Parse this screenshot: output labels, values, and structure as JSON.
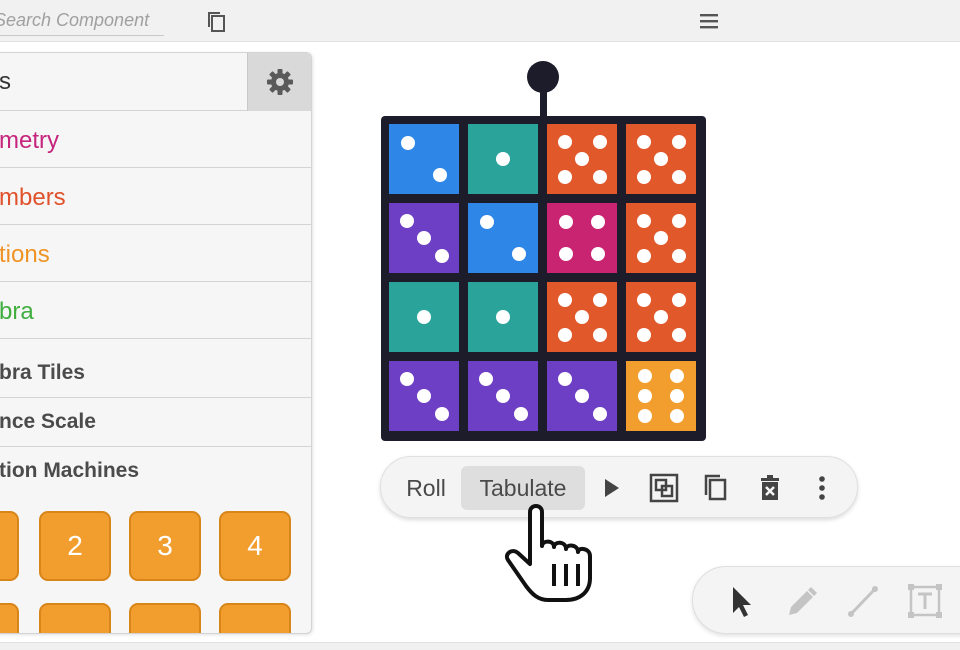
{
  "topbar": {
    "search_placeholder": "Search Component",
    "copy_icon": "copy-icon",
    "menu_icon": "hamburger-menu-icon"
  },
  "panel": {
    "title": "s",
    "gear_icon": "gear-icon",
    "categories": [
      {
        "label": "metry",
        "color": "#c6257d"
      },
      {
        "label": "mbers",
        "color": "#e0522b"
      },
      {
        "label": "tions",
        "color": "#ef9424"
      },
      {
        "label": "bra",
        "color": "#3fae3f"
      }
    ],
    "subcategories": [
      "bra Tiles",
      "nce Scale",
      "tion Machines"
    ],
    "number_tiles": [
      "",
      "2",
      "3",
      "4",
      "",
      "",
      "",
      ""
    ]
  },
  "dice": {
    "colors": {
      "blue": "#2e86e6",
      "teal": "#2aa39b",
      "orange": "#e1582b",
      "purple": "#6d3fc4",
      "magenta": "#c82472",
      "yellow": "#f19e2e"
    },
    "grid": [
      [
        {
          "color": "blue",
          "value": 2
        },
        {
          "color": "teal",
          "value": 1
        },
        {
          "color": "orange",
          "value": 5
        },
        {
          "color": "orange",
          "value": 5
        }
      ],
      [
        {
          "color": "purple",
          "value": 3
        },
        {
          "color": "blue",
          "value": 2
        },
        {
          "color": "magenta",
          "value": 4
        },
        {
          "color": "orange",
          "value": 5
        }
      ],
      [
        {
          "color": "teal",
          "value": 1
        },
        {
          "color": "teal",
          "value": 1
        },
        {
          "color": "orange",
          "value": 5
        },
        {
          "color": "orange",
          "value": 5
        }
      ],
      [
        {
          "color": "purple",
          "value": 3
        },
        {
          "color": "purple",
          "value": 3
        },
        {
          "color": "purple",
          "value": 3
        },
        {
          "color": "yellow",
          "value": 6
        }
      ]
    ]
  },
  "toolbar": {
    "roll_label": "Roll",
    "tabulate_label": "Tabulate",
    "icons": [
      "play-icon",
      "group-icon",
      "duplicate-icon",
      "delete-icon",
      "more-vertical-icon"
    ]
  },
  "tools": {
    "icons": [
      "select-arrow-icon",
      "pen-icon",
      "line-icon",
      "text-box-icon"
    ]
  }
}
